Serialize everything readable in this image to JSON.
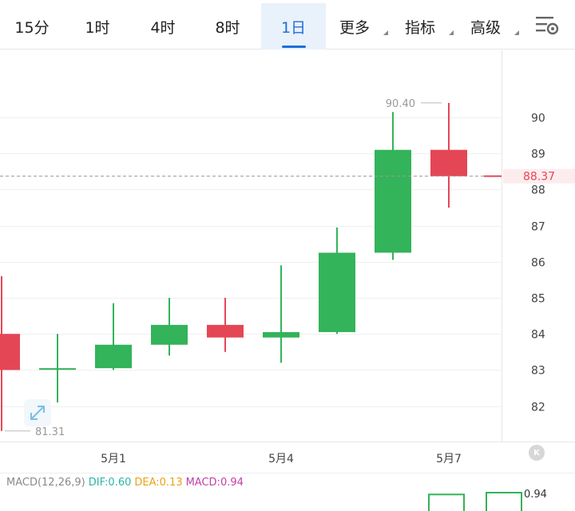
{
  "tabs": [
    {
      "label": "15分",
      "active": false,
      "caret": false
    },
    {
      "label": "1时",
      "active": false,
      "caret": false
    },
    {
      "label": "4时",
      "active": false,
      "caret": false
    },
    {
      "label": "8时",
      "active": false,
      "caret": false
    },
    {
      "label": "1日",
      "active": true,
      "caret": false
    },
    {
      "label": "更多",
      "active": false,
      "caret": true
    },
    {
      "label": "指标",
      "active": false,
      "caret": true
    },
    {
      "label": "高级",
      "active": false,
      "caret": true
    }
  ],
  "icons": {
    "settings": "chart-settings-icon",
    "expand": "expand-arrows-icon",
    "kline_badge": "k-badge-icon"
  },
  "kline_badge_label": "K",
  "colors": {
    "up": "#33b35a",
    "down": "#e54656",
    "accent": "#1d6fd6",
    "macd_dif": "#2bb5a8",
    "macd_dea": "#e8a315",
    "macd_macd": "#c23ea8"
  },
  "macd": {
    "title": "MACD(12,26,9)",
    "dif": "DIF:0.60",
    "dea": "DEA:0.13",
    "macd": "MACD:0.94",
    "axis_value": "0.94"
  },
  "chart_data": {
    "type": "candlestick",
    "y_ticks": [
      82,
      83,
      84,
      85,
      86,
      87,
      88,
      89,
      90
    ],
    "ylim": [
      81.0,
      91.0
    ],
    "x_tick_labels": [
      {
        "label": "5月1",
        "index": 2
      },
      {
        "label": "5月4",
        "index": 5
      },
      {
        "label": "5月7",
        "index": 8
      }
    ],
    "current_price": "88.37",
    "high_label": "90.40",
    "low_label": "81.31",
    "candles": [
      {
        "open": 84.0,
        "close": 83.0,
        "high": 85.6,
        "low": 81.31
      },
      {
        "open": 83.05,
        "close": 83.05,
        "high": 84.0,
        "low": 82.1
      },
      {
        "open": 83.05,
        "close": 83.7,
        "high": 84.85,
        "low": 83.0
      },
      {
        "open": 83.7,
        "close": 84.25,
        "high": 85.0,
        "low": 83.4
      },
      {
        "open": 84.25,
        "close": 83.9,
        "high": 85.0,
        "low": 83.5
      },
      {
        "open": 83.9,
        "close": 84.05,
        "high": 85.9,
        "low": 83.2
      },
      {
        "open": 84.05,
        "close": 86.25,
        "high": 86.95,
        "low": 84.0
      },
      {
        "open": 86.25,
        "close": 89.1,
        "high": 90.15,
        "low": 86.05
      },
      {
        "open": 89.1,
        "close": 88.37,
        "high": 90.4,
        "low": 87.5
      }
    ],
    "macd_histogram_visible": [
      0.85,
      0.94
    ]
  }
}
